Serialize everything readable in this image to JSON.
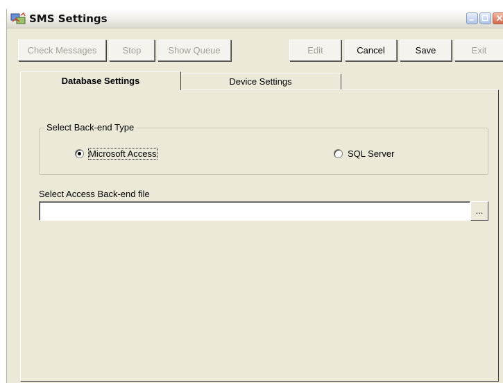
{
  "window": {
    "title": "SMS Settings",
    "icon": "sms-app-icon"
  },
  "toolbar": {
    "check_messages_label": "Check Messages",
    "stop_label": "Stop",
    "show_queue_label": "Show Queue",
    "edit_label": "Edit",
    "cancel_label": "Cancel",
    "save_label": "Save",
    "exit_label": "Exit"
  },
  "tabs": [
    {
      "label": "Database Settings",
      "active": true
    },
    {
      "label": "Device Settings",
      "active": false
    }
  ],
  "backend_group": {
    "legend": "Select Back-end Type",
    "options": [
      {
        "label": "Microsoft Access",
        "checked": true
      },
      {
        "label": "SQL Server",
        "checked": false
      }
    ]
  },
  "access_file": {
    "label": "Select Access Back-end file",
    "value": "",
    "browse_label": "..."
  },
  "colors": {
    "window_bg": "#ece9d8",
    "disabled_text": "#a3a197"
  }
}
